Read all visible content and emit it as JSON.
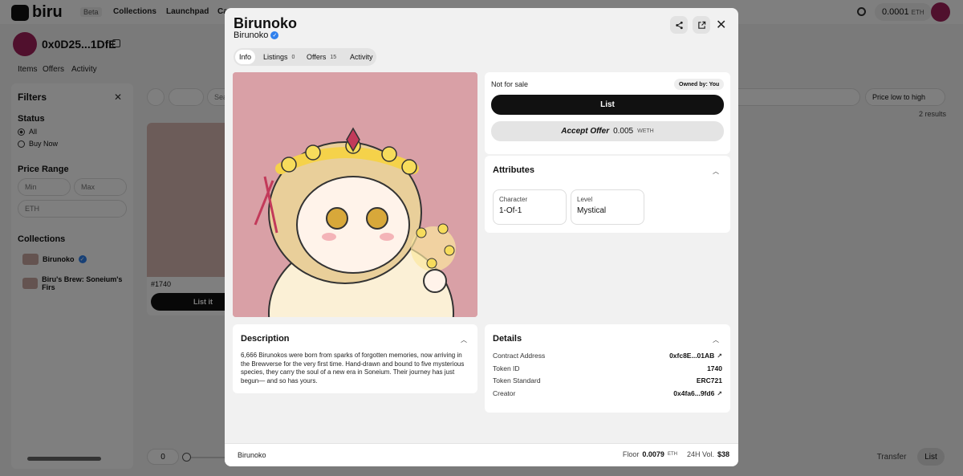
{
  "header": {
    "logo": "biru",
    "beta": "Beta",
    "nav": [
      "Collections",
      "Launchpad",
      "Ca"
    ],
    "balance_value": "0.0001",
    "balance_unit": "ETH"
  },
  "profile": {
    "address": "0x0D25...1DfE",
    "tabs": [
      "Items",
      "Offers",
      "Activity"
    ]
  },
  "filters": {
    "title": "Filters",
    "status_title": "Status",
    "status_options": [
      "All",
      "Buy Now"
    ],
    "price_title": "Price Range",
    "min_placeholder": "Min",
    "max_placeholder": "Max",
    "currency": "ETH",
    "collections_title": "Collections",
    "collections": [
      "Birunoko",
      "Biru's Brew: Soneium's Firs"
    ]
  },
  "main": {
    "search_placeholder": "Sea",
    "sort": "Price low to high",
    "results": "2 results",
    "card_id": "#1740",
    "card_button": "List it",
    "bottom_value": "0",
    "transfer_label": "Transfer",
    "list_label": "List"
  },
  "modal": {
    "title": "Birunoko",
    "collection": "Birunoko",
    "tabs": [
      {
        "label": "Info",
        "count": ""
      },
      {
        "label": "Listings",
        "count": "0"
      },
      {
        "label": "Offers",
        "count": "15"
      },
      {
        "label": "Activity",
        "count": ""
      }
    ],
    "sale_status": "Not for sale",
    "owned_badge": "Owned by: You",
    "list_button": "List",
    "accept_offer_label": "Accept Offer",
    "accept_offer_value": "0.005",
    "accept_offer_unit": "WETH",
    "attributes_title": "Attributes",
    "attributes": [
      {
        "trait": "Character",
        "value": "1-Of-1"
      },
      {
        "trait": "Level",
        "value": "Mystical"
      }
    ],
    "description_title": "Description",
    "description": "6,666 Birunokos were born from sparks of forgotten memories, now arriving in the Brewverse for the very first time. Hand-drawn and bound to five mysterious species, they carry the soul of a new era in Soneium. Their journey has just begun— and so has yours.",
    "details_title": "Details",
    "details": [
      {
        "label": "Contract Address",
        "value": "0xfc8E...01AB"
      },
      {
        "label": "Token ID",
        "value": "1740"
      },
      {
        "label": "Token Standard",
        "value": "ERC721"
      },
      {
        "label": "Creator",
        "value": "0x4fa6...9fd6"
      }
    ],
    "footer_collection": "Birunoko",
    "floor_label": "Floor",
    "floor_value": "0.0079",
    "floor_unit": "ETH",
    "vol_label": "24H Vol.",
    "vol_value": "$38"
  },
  "colors": {
    "accent": "#111111",
    "avatar": "#a0205a",
    "verified": "#2f80ed",
    "nft_background": "#d9a0a6"
  }
}
